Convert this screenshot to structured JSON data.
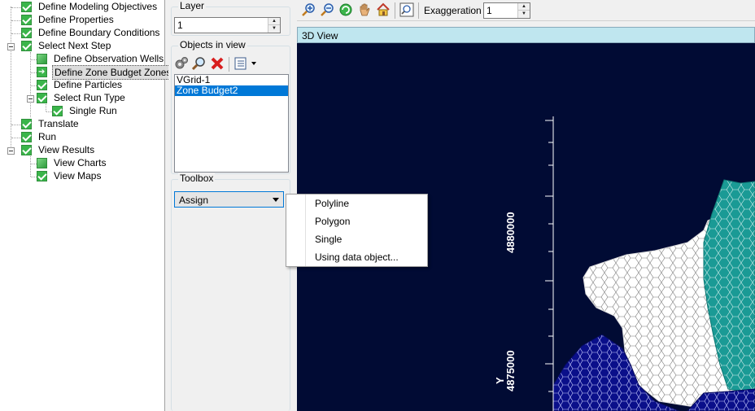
{
  "tree": {
    "items": [
      {
        "label": "Define Modeling Objectives"
      },
      {
        "label": "Define Properties"
      },
      {
        "label": "Define Boundary Conditions"
      },
      {
        "label": "Select Next Step"
      },
      {
        "label": "Define Observation Wells"
      },
      {
        "label": "Define Zone Budget Zones"
      },
      {
        "label": "Define Particles"
      },
      {
        "label": "Select Run Type"
      },
      {
        "label": "Single Run"
      },
      {
        "label": "Translate"
      },
      {
        "label": "Run"
      },
      {
        "label": "View Results"
      },
      {
        "label": "View Charts"
      },
      {
        "label": "View Maps"
      }
    ]
  },
  "layer": {
    "title": "Layer",
    "value": "1"
  },
  "objects": {
    "title": "Objects in view",
    "items": [
      "VGrid-1",
      "Zone Budget2"
    ]
  },
  "toolbox": {
    "title": "Toolbox",
    "selected": "Assign",
    "options": [
      "Polyline",
      "Polygon",
      "Single",
      "Using data object..."
    ]
  },
  "toolbar": {
    "exaggeration_label": "Exaggeration",
    "exaggeration_value": "1"
  },
  "view": {
    "title": "3D View",
    "tick_labels": [
      "4880000",
      "4875000"
    ],
    "y_axis_label": "Y"
  },
  "colors": {
    "view_bg": "#010b34",
    "zone_white": "#ffffff",
    "zone_teal": "#1a9a95",
    "zone_blue": "#0a0f8a",
    "selection": "#0078d7"
  }
}
